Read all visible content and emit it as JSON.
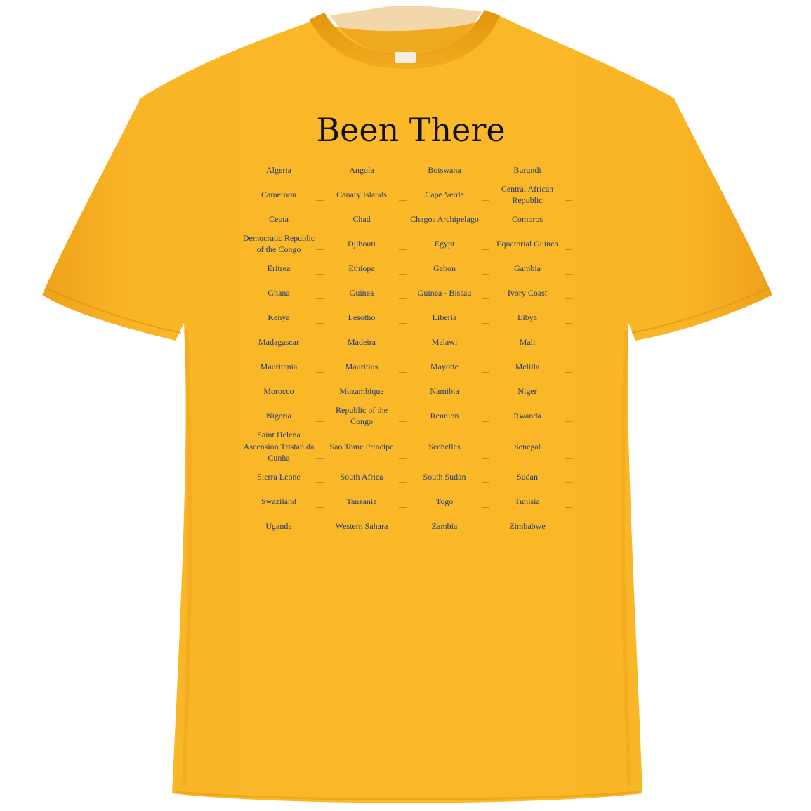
{
  "design": {
    "title": "Been There",
    "countries": [
      "Algeria",
      "Angola",
      "Botswana",
      "Burundi",
      "Cameroon",
      "Canary Islands",
      "Cape Verde",
      "Central African Republic",
      "Ceuta",
      "Chad",
      "Chagos Archipelago",
      "Comoros",
      "Democratic Republic of the Congo",
      "Djibouti",
      "Egypt",
      "Equatorial   Guinea",
      "Eritrea",
      "Ethiopa",
      "Gabon",
      "Gambia",
      "Ghana",
      "Guinea",
      "Guinea - Bissau",
      "Ivory Coast",
      "Kenya",
      "Lesotho",
      "Liberia",
      "Libya",
      "Madagascar",
      "Madeira",
      "Malawi",
      "Mali",
      "Mauritania",
      "Mauritius",
      "Mayotte",
      "Melilla",
      "Morocco",
      "Mozambique",
      "Namibia",
      "Niger",
      "Nigeria",
      "Republic of the Congo",
      "Reunion",
      "Rwanda",
      "Saint Helena Ascension   Tristan da Cunha",
      "Sao Tome Principe",
      "Sechelles",
      "Senegal",
      "Sierra Leone",
      "South Africa",
      "South Sudan",
      "Sudan",
      "Swaziland",
      "Tanzania",
      "Togo",
      "Tunisia",
      "Uganda",
      "Western Sahara",
      "Zambia",
      "Zimbabwe"
    ]
  },
  "colors": {
    "shirt": "#f9b424",
    "shirt_shadow": "#e79c12",
    "title_text": "#111111",
    "country_text": "#1e3a7a"
  }
}
